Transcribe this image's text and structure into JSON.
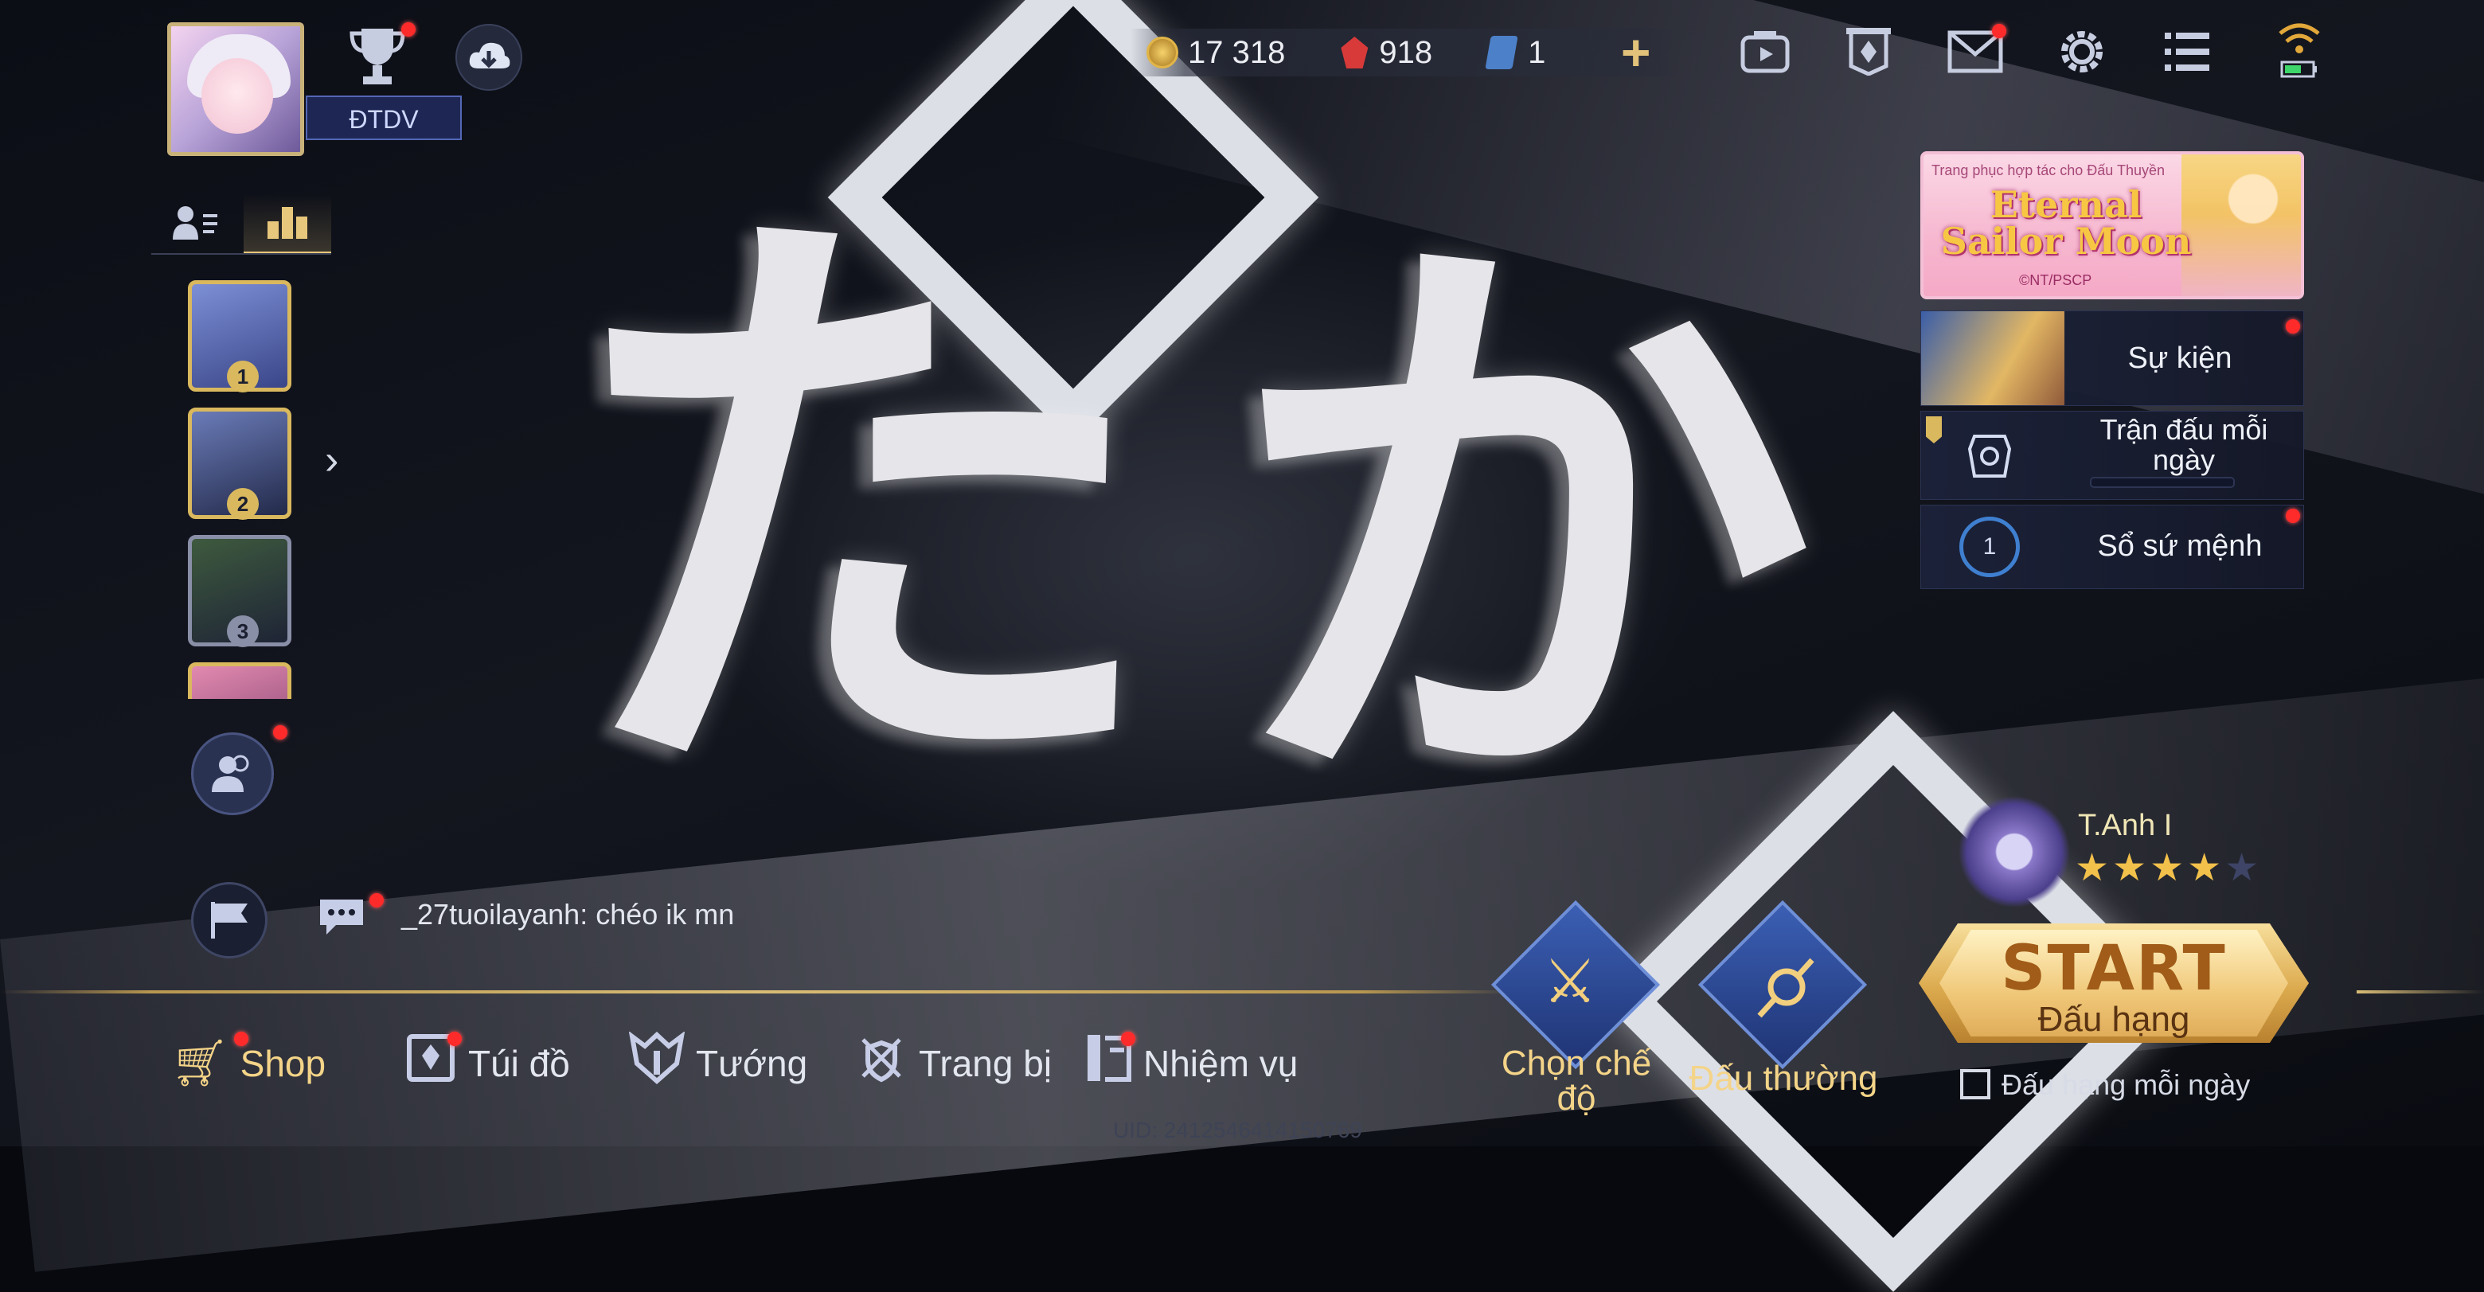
{
  "profile": {
    "tag": "ĐTDV"
  },
  "currency": {
    "gold": "17 318",
    "gems": "918",
    "vouchers": "1"
  },
  "icons": {
    "trophy": "trophy-icon",
    "download": "cloud-download-icon",
    "recording": "camera-icon",
    "banner": "banner-icon",
    "mail": "mail-icon",
    "settings": "gear-icon",
    "menu": "list-icon",
    "signal": "wifi-battery-icon"
  },
  "leaderboard": {
    "ranks": [
      "1",
      "2",
      "3"
    ]
  },
  "chat": {
    "message": "_27tuoilayanh: chéo ik mn"
  },
  "promo": {
    "small_text": "Trang phục hợp tác cho Đấu Thuyền",
    "title_line1": "Eternal",
    "title_line2": "Sailor Moon",
    "copyright": "©NT/PSCP"
  },
  "events": {
    "event": "Sự kiện",
    "daily_match": "Trận đấu mỗi ngày",
    "mission_book": "Sổ sứ mệnh",
    "mission_level": "1"
  },
  "rank": {
    "name": "T.Anh I",
    "stars_filled": 4,
    "stars_total": 5
  },
  "modes": {
    "choose": "Chọn chế độ",
    "normal": "Đấu thường"
  },
  "start": {
    "label": "START",
    "sub": "Đấu hạng",
    "daily": "Đấu hạng mỗi ngày"
  },
  "nav": {
    "shop": "Shop",
    "bag": "Túi đồ",
    "heroes": "Tướng",
    "equipment": "Trang bị",
    "missions": "Nhiệm vụ"
  },
  "uid": "UID: 2412546414150769",
  "colors": {
    "accent_gold": "#d9bd76",
    "alert_red": "#ff2a2a",
    "panel_blue": "#1e2754"
  }
}
